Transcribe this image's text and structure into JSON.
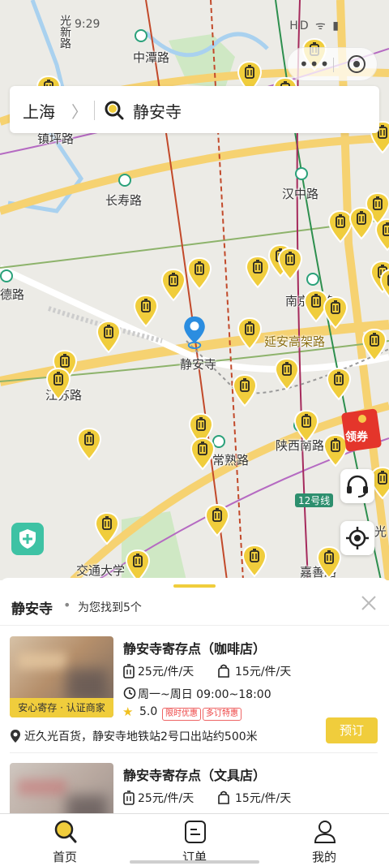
{
  "status": {
    "time": "9:29",
    "right": "HD ᯤ ▮"
  },
  "search": {
    "city": "上海",
    "chevron": "〉",
    "query": "静安寺"
  },
  "map": {
    "labels": {
      "guangxin": "光新路",
      "zhongtan": "中潭路",
      "zhenping": "镇坪路",
      "changshou": "长寿路",
      "hanzhong": "汉中路",
      "jiangsu": "江苏路",
      "de": "德路",
      "jingansi": "静安寺",
      "nanjing": "南京西路",
      "yanan": "延安高架路",
      "shaanxi": "陕西南路",
      "changshu": "常熟路",
      "jiaotong": "交通大学",
      "jiashan": "嘉善路",
      "line12": "12号线",
      "guang": "光"
    },
    "coupon": "领券",
    "icons": {
      "pin": "luggage-pin-icon",
      "current": "location-marker-icon",
      "shield": "shield-plus-icon",
      "support": "headset-icon",
      "locate": "crosshair-icon"
    }
  },
  "sheet": {
    "title": "静安寺",
    "dot": "•",
    "count": "为您找到5个"
  },
  "stores": [
    {
      "name": "静安寺寄存点（咖啡店）",
      "price_large": "25元/件/天",
      "price_small": "15元/件/天",
      "hours": "周一~周日 09:00~18:00",
      "rating": "5.0",
      "tags": [
        "限时优惠",
        "多订特惠"
      ],
      "badge": "安心寄存 · 认证商家",
      "address": "近久光百货，静安寺地铁站2号口出站约500米",
      "book": "预订"
    },
    {
      "name": "静安寺寄存点（文具店）",
      "price_large": "25元/件/天",
      "price_small": "15元/件/天"
    }
  ],
  "tabs": [
    {
      "label": "首页"
    },
    {
      "label": "订单"
    },
    {
      "label": "我的"
    }
  ],
  "colors": {
    "accent": "#f0cd3c",
    "metro": "#2aa17a",
    "road": "#f6d271"
  }
}
